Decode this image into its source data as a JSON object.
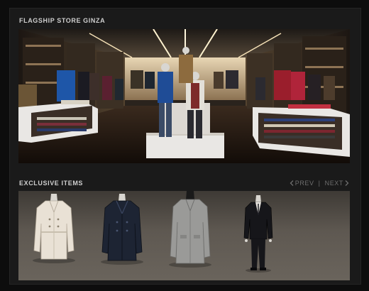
{
  "store": {
    "title": "FLAGSHIP STORE GINZA"
  },
  "exclusive": {
    "title": "EXCLUSIVE ITEMS",
    "prev_label": "PREV",
    "next_label": "NEXT",
    "separator": "|"
  },
  "colors": {
    "page_background": "#0d0d0d",
    "panel_background": "#1a1a1a",
    "title_text": "#cfcfcf",
    "pager_text": "#6e6e6e",
    "trench_beige": "#e9e1d5",
    "peacoat_navy": "#1d2433",
    "grey_overcoat": "#9a9a98",
    "black_suit": "#16161a"
  },
  "icons": [
    "chevron-left-icon",
    "chevron-right-icon"
  ],
  "items": [
    {
      "name": "trench-coat-item"
    },
    {
      "name": "peacoat-item"
    },
    {
      "name": "overcoat-item"
    },
    {
      "name": "suit-item"
    }
  ]
}
